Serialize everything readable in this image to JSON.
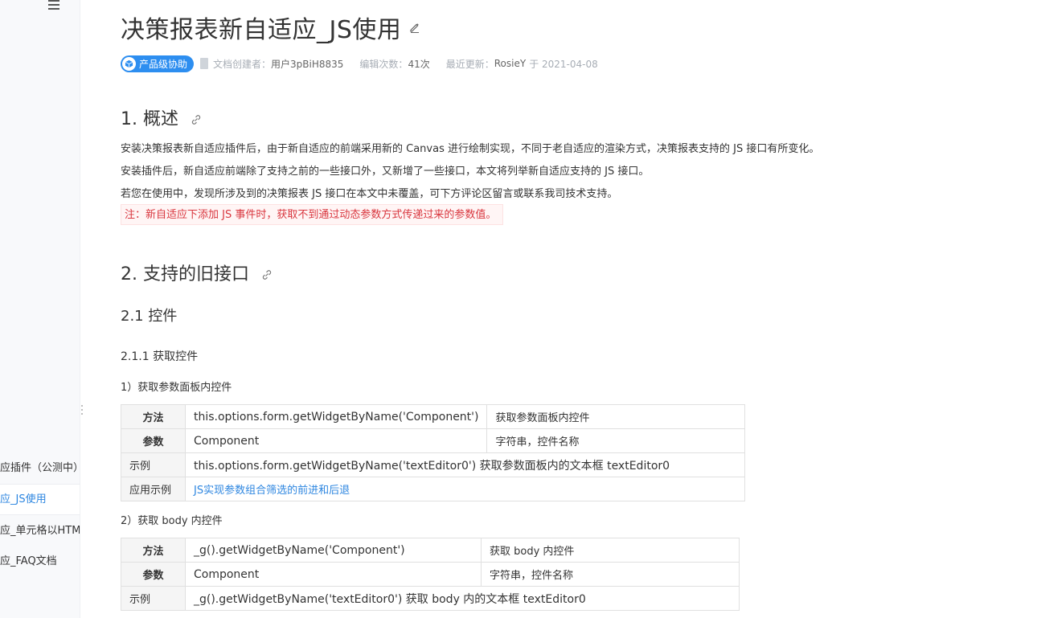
{
  "sidebar": {
    "items": [
      {
        "label": "应插件（公测中）"
      },
      {
        "label": "应_JS使用",
        "active": true
      },
      {
        "label": "应_单元格以HTML"
      },
      {
        "label": "应_FAQ文档"
      }
    ]
  },
  "page": {
    "title": "决策报表新自适应_JS使用",
    "badge": "产品级协助",
    "creator_label": "文档创建者：",
    "creator": "用户3pBiH8835",
    "edits_label": "编辑次数：",
    "edits": "41次",
    "updated_label": "最近更新：",
    "updated_by": "RosieY",
    "updated_on": "于 2021-04-08"
  },
  "sections": {
    "overview_title": "1. 概述",
    "overview_p1": "安装决策报表新自适应插件后，由于新自适应的前端采用新的 Canvas 进行绘制实现，不同于老自适应的渲染方式，决策报表支持的 JS 接口有所变化。",
    "overview_p2": "安装插件后，新自适应前端除了支持之前的一些接口外，又新增了一些接口，本文将列举新自适应支持的 JS 接口。",
    "overview_p3": "若您在使用中，发现所涉及到的决策报表 JS 接口在本文中未覆盖，可下方评论区留言或联系我司技术支持。",
    "overview_note": "注：新自适应下添加 JS 事件时，获取不到通过动态参数方式传递过来的参数值。",
    "old_api_title": "2. 支持的旧接口",
    "widgets_title": "2.1 控件",
    "get_widgets_title": "2.1.1 获取控件",
    "item1_title": "1）获取参数面板内控件",
    "item2_title": "2）获取 body 内控件"
  },
  "table1": {
    "rows": [
      {
        "k": "方法",
        "v": "this.options.form.getWidgetByName('Component')",
        "d": "获取参数面板内控件"
      },
      {
        "k": "参数",
        "v": "Component",
        "d": "字符串，控件名称"
      },
      {
        "k": "示例",
        "v": "this.options.form.getWidgetByName('textEditor0') 获取参数面板内的文本框 textEditor0"
      },
      {
        "k": "应用示例",
        "link": "JS实现参数组合筛选的前进和后退"
      }
    ]
  },
  "table2": {
    "rows": [
      {
        "k": "方法",
        "v": "_g().getWidgetByName('Component')",
        "d": "获取 body 内控件"
      },
      {
        "k": "参数",
        "v": "Component",
        "d": "字符串，控件名称"
      },
      {
        "k": "示例",
        "v": "_g().getWidgetByName('textEditor0') 获取 body 内的文本框 textEditor0"
      }
    ]
  },
  "colors": {
    "accent": "#2d86e0",
    "badge": "#2d8ef0",
    "note_text": "#d9363e"
  },
  "icons": [
    "menu-icon",
    "edit-icon",
    "link-icon",
    "document-icon",
    "cube-icon"
  ]
}
